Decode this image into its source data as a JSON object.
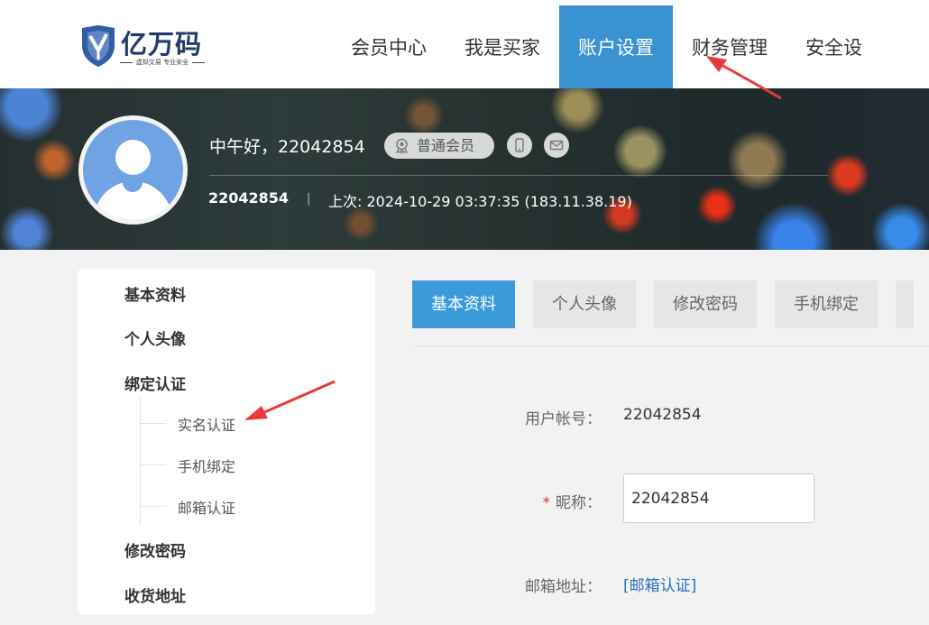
{
  "logo": {
    "title": "亿万码",
    "subtitle": "虚拟交易 专业安全"
  },
  "nav": {
    "items": [
      {
        "label": "会员中心"
      },
      {
        "label": "我是买家"
      },
      {
        "label": "账户设置"
      },
      {
        "label": "财务管理"
      },
      {
        "label": "安全设"
      }
    ]
  },
  "profile": {
    "greeting": "中午好，22042854",
    "member_level": "普通会员",
    "user_id": "22042854",
    "separator": "|",
    "last_login": "上次: 2024-10-29 03:37:35 (183.11.38.19)"
  },
  "sidebar": {
    "items": [
      {
        "label": "基本资料"
      },
      {
        "label": "个人头像"
      },
      {
        "label": "绑定认证"
      },
      {
        "label": "修改密码"
      },
      {
        "label": "收货地址"
      }
    ],
    "sub_items": [
      {
        "label": "实名认证"
      },
      {
        "label": "手机绑定"
      },
      {
        "label": "邮箱认证"
      }
    ]
  },
  "tabs": [
    {
      "label": "基本资料"
    },
    {
      "label": "个人头像"
    },
    {
      "label": "修改密码"
    },
    {
      "label": "手机绑定"
    }
  ],
  "form": {
    "account_label": "用户帐号：",
    "account_value": "22042854",
    "required_mark": "*",
    "nickname_label": "昵称：",
    "nickname_value": "22042854",
    "email_label": "邮箱地址：",
    "email_link": "[邮箱认证]"
  },
  "colors": {
    "accent": "#3b92d1",
    "arrow": "#e8393a",
    "required": "#e0313a",
    "link": "#2f6fc0"
  },
  "icons": [
    "shield-logo-icon",
    "medal-icon",
    "phone-icon",
    "mail-icon",
    "avatar-icon"
  ]
}
